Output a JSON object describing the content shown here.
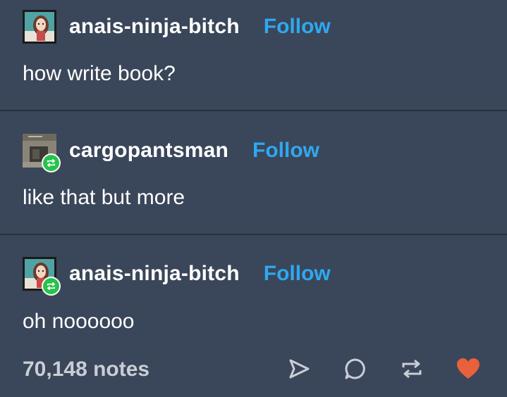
{
  "posts": [
    {
      "username": "anais-ninja-bitch",
      "follow_label": "Follow",
      "text": "how write book?",
      "avatar_icon": "portrait-avatar-icon",
      "reblogged": false
    },
    {
      "username": "cargopantsman",
      "follow_label": "Follow",
      "text": "like that but more",
      "avatar_icon": "photo-avatar-icon",
      "reblogged": true
    },
    {
      "username": "anais-ninja-bitch",
      "follow_label": "Follow",
      "text": "oh noooooo",
      "avatar_icon": "portrait-avatar-icon",
      "reblogged": true
    }
  ],
  "footer": {
    "notes": "70,148 notes",
    "actions": [
      "share-icon",
      "reply-icon",
      "reblog-icon",
      "like-icon"
    ]
  },
  "colors": {
    "background": "#3a4659",
    "divider": "#253041",
    "follow": "#2fa8f0",
    "reblog_badge": "#27c24c",
    "like": "#e8613c"
  }
}
